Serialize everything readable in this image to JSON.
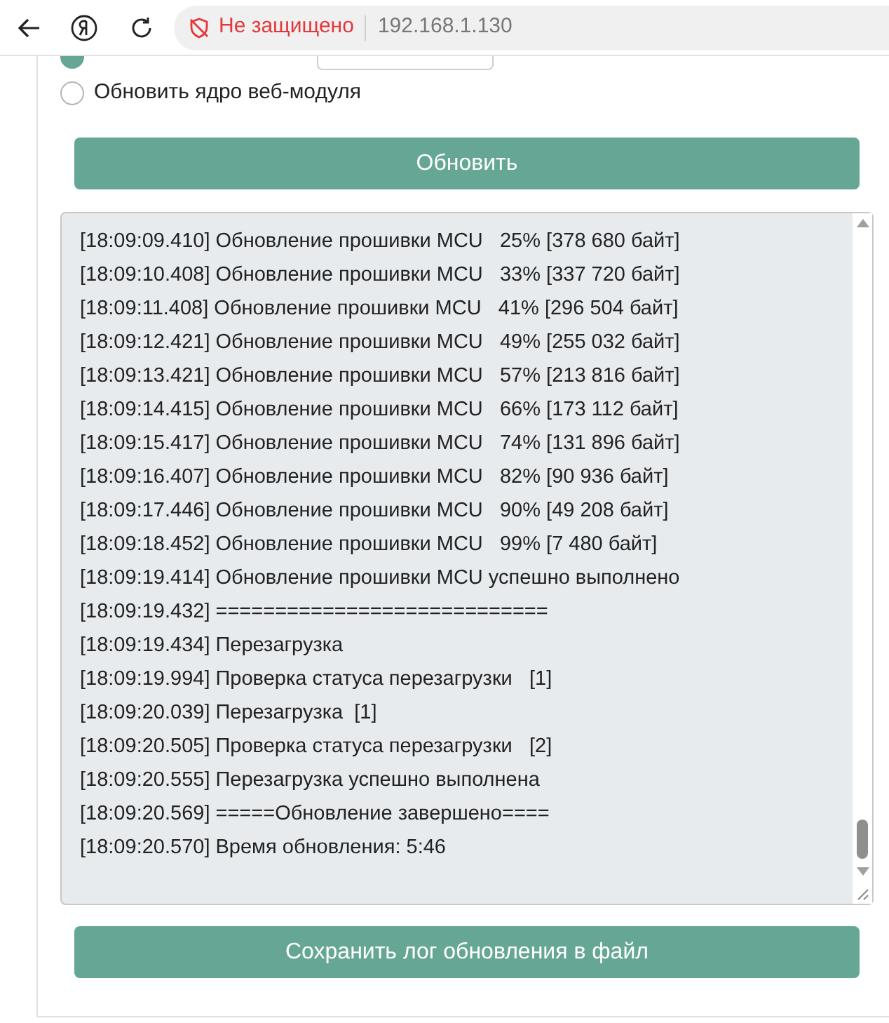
{
  "browser": {
    "security_label": "Не защищено",
    "address": "192.168.1.130"
  },
  "options": [
    {
      "selected": true
    },
    {
      "label": "Обновить ядро веб-модуля",
      "selected": false
    }
  ],
  "update_button": "Обновить",
  "log": [
    "[18:09:09.410] Обновление прошивки MCU   25% [378 680 байт]",
    "[18:09:10.408] Обновление прошивки MCU   33% [337 720 байт]",
    "[18:09:11.408] Обновление прошивки MCU   41% [296 504 байт]",
    "[18:09:12.421] Обновление прошивки MCU   49% [255 032 байт]",
    "[18:09:13.421] Обновление прошивки MCU   57% [213 816 байт]",
    "[18:09:14.415] Обновление прошивки MCU   66% [173 112 байт]",
    "[18:09:15.417] Обновление прошивки MCU   74% [131 896 байт]",
    "[18:09:16.407] Обновление прошивки MCU   82% [90 936 байт]",
    "[18:09:17.446] Обновление прошивки MCU   90% [49 208 байт]",
    "[18:09:18.452] Обновление прошивки MCU   99% [7 480 байт]",
    "[18:09:19.414] Обновление прошивки MCU успешно выполнено",
    "[18:09:19.432] ============================",
    "[18:09:19.434] Перезагрузка",
    "[18:09:19.994] Проверка статуса перезагрузки   [1]",
    "[18:09:20.039] Перезагрузка  [1]",
    "[18:09:20.505] Проверка статуса перезагрузки   [2]",
    "[18:09:20.555] Перезагрузка успешно выполнена",
    "[18:09:20.569] =====Обновление завершено====",
    "[18:09:20.570] Время обновления: 5:46"
  ],
  "save_button": "Сохранить лог обновления в файл"
}
